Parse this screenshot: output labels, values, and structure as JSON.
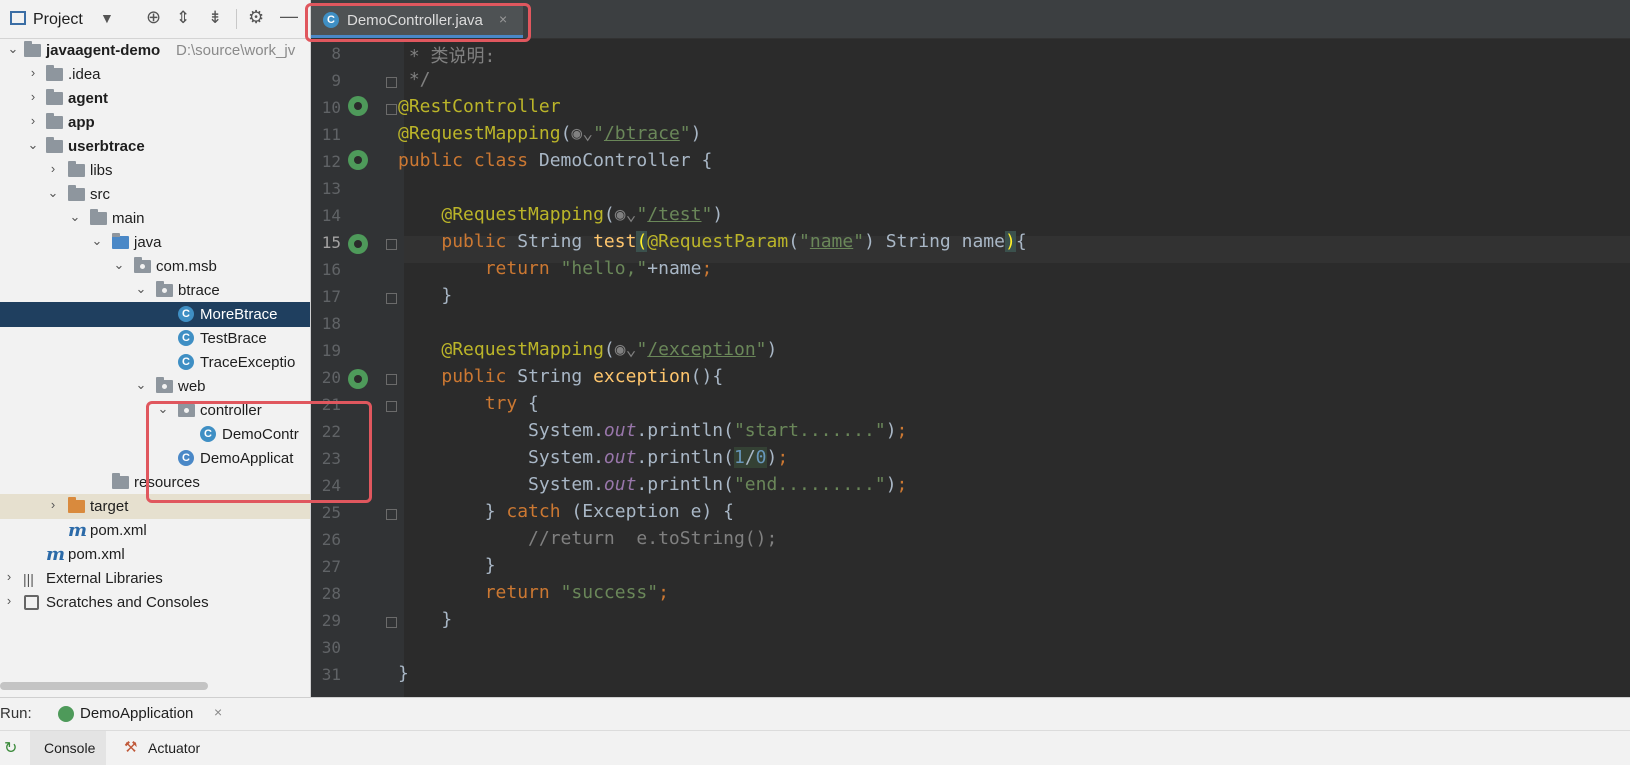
{
  "toolbar": {
    "project_label": "Project"
  },
  "tree": {
    "root_name": "javaagent-demo",
    "root_path": "D:\\source\\work_jv",
    "items": [
      {
        "label": "javaagent-demo"
      },
      {
        "label": ".idea"
      },
      {
        "label": "agent"
      },
      {
        "label": "app"
      },
      {
        "label": "userbtrace"
      },
      {
        "label": "libs"
      },
      {
        "label": "src"
      },
      {
        "label": "main"
      },
      {
        "label": "java"
      },
      {
        "label": "com.msb"
      },
      {
        "label": "btrace"
      },
      {
        "label": "MoreBtrace"
      },
      {
        "label": "TestBrace"
      },
      {
        "label": "TraceExceptio"
      },
      {
        "label": "web"
      },
      {
        "label": "controller"
      },
      {
        "label": "DemoContr"
      },
      {
        "label": "DemoApplicat"
      },
      {
        "label": "resources"
      },
      {
        "label": "target"
      },
      {
        "label": "pom.xml"
      },
      {
        "label": "pom.xml"
      },
      {
        "label": "External Libraries"
      },
      {
        "label": "Scratches and Consoles"
      }
    ]
  },
  "editor": {
    "tab_label": "DemoController.java",
    "line_numbers": [
      "8",
      "9",
      "10",
      "11",
      "12",
      "13",
      "14",
      "15",
      "16",
      "17",
      "18",
      "19",
      "20",
      "21",
      "22",
      "23",
      "24",
      "25",
      "26",
      "27",
      "28",
      "29",
      "30",
      "31"
    ]
  },
  "bottom": {
    "run_label": "Run:",
    "run_config": "DemoApplication",
    "console_tab": "Console",
    "actuator_tab": "Actuator"
  },
  "colors": {
    "accent": "#4a88c7",
    "highlight": "#e0575e",
    "selection": "#1f3f5f"
  }
}
